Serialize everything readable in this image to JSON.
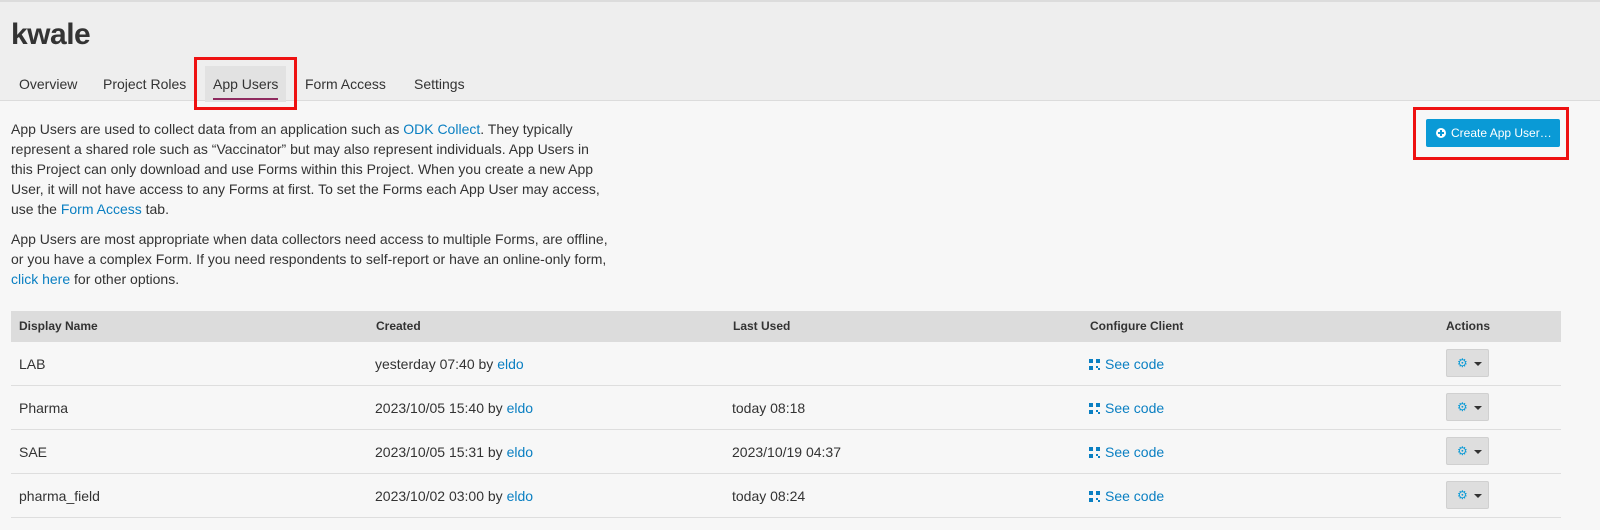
{
  "project": {
    "title": "kwale"
  },
  "tabs": [
    {
      "label": "Overview"
    },
    {
      "label": "Project Roles"
    },
    {
      "label": "App Users",
      "active": true
    },
    {
      "label": "Form Access"
    },
    {
      "label": "Settings"
    }
  ],
  "intro": {
    "p1_before": "App Users are used to collect data from an application such as ",
    "p1_link1": "ODK Collect",
    "p1_middle": ". They typically represent a shared role such as “Vaccinator” but may also represent individuals. App Users in this Project can only download and use Forms within this Project. When you create a new App User, it will not have access to any Forms at first. To set the Forms each App User may access, use the ",
    "p1_link2": "Form Access",
    "p1_after": " tab.",
    "p2_before": "App Users are most appropriate when data collectors need access to multiple Forms, are offline, or you have a complex Form. If you need respondents to self-report or have an online-only form, ",
    "p2_link": "click here",
    "p2_after": " for other options."
  },
  "create_button": {
    "label": "Create App User…",
    "icon": "plus-circle-icon"
  },
  "table": {
    "headers": {
      "display_name": "Display Name",
      "created": "Created",
      "last_used": "Last Used",
      "configure_client": "Configure Client",
      "actions": "Actions"
    },
    "see_code_label": "See code",
    "by_label": " by ",
    "rows": [
      {
        "name": "LAB",
        "created": "yesterday 07:40",
        "created_by": "eldo",
        "last_used": ""
      },
      {
        "name": "Pharma",
        "created": "2023/10/05 15:40",
        "created_by": "eldo",
        "last_used": "today 08:18"
      },
      {
        "name": "SAE",
        "created": "2023/10/05 15:31",
        "created_by": "eldo",
        "last_used": "2023/10/19 04:37"
      },
      {
        "name": "pharma_field",
        "created": "2023/10/02 03:00",
        "created_by": "eldo",
        "last_used": "today 08:24"
      }
    ]
  },
  "colors": {
    "accent": "#0a9ad6",
    "link": "#0a7fc2",
    "active_tab_underline": "#8e2a5f",
    "highlight": "#ee1111"
  }
}
